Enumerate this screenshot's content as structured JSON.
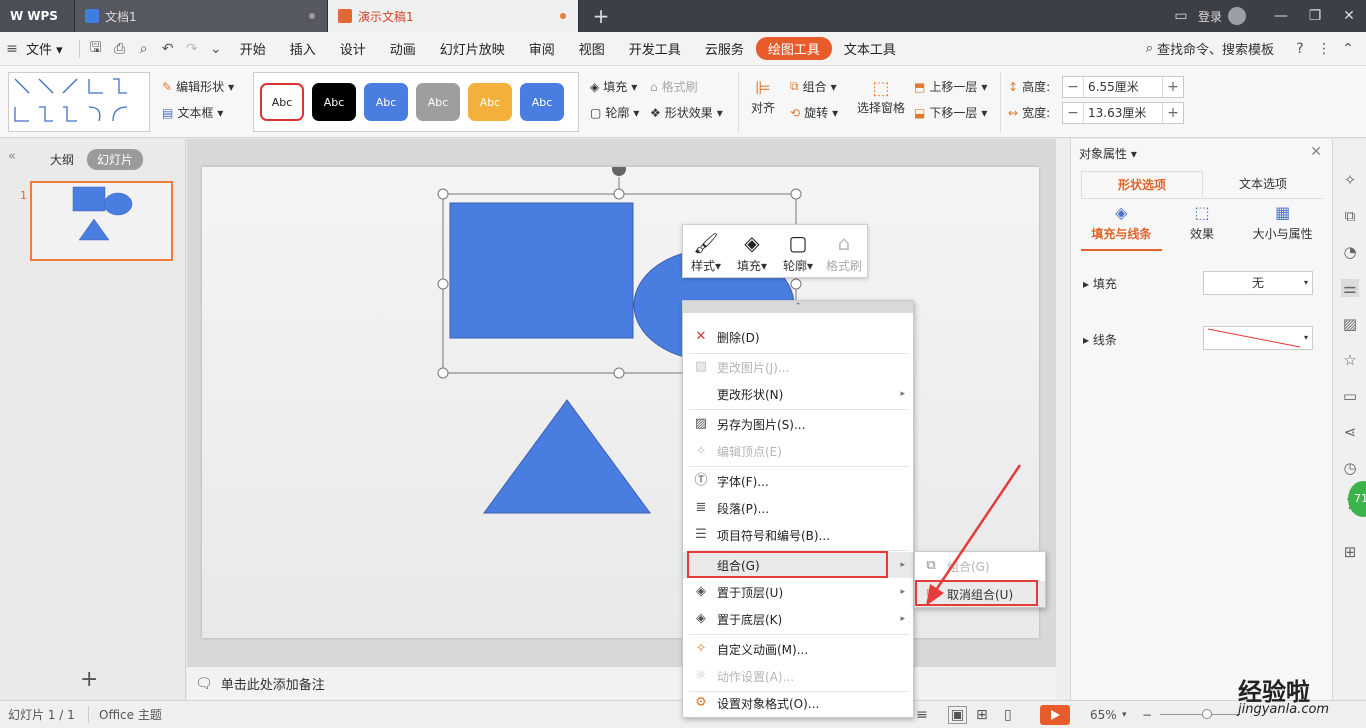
{
  "titlebar": {
    "wps_label": "WPS",
    "doc_tab": "文档1",
    "active_tab": "演示文稿1",
    "login": "登录"
  },
  "menubar": {
    "file": "文件",
    "items": [
      "开始",
      "插入",
      "设计",
      "动画",
      "幻灯片放映",
      "审阅",
      "视图",
      "开发工具",
      "云服务"
    ],
    "highlight": "绘图工具",
    "text_tools": "文本工具",
    "search": "查找命令、搜索模板"
  },
  "ribbon": {
    "edit_shape": "编辑形状",
    "text_box": "文本框",
    "style_samples": [
      "Abc",
      "Abc",
      "Abc",
      "Abc",
      "Abc",
      "Abc"
    ],
    "style_colors": [
      "#ffffff",
      "#000000",
      "#4a7de0",
      "#9e9e9e",
      "#f3b13b",
      "#4a7de0"
    ],
    "fill": "填充",
    "format_brush": "格式刷",
    "outline": "轮廓",
    "shape_effects": "形状效果",
    "align": "对齐",
    "group": "组合",
    "rotate": "旋转",
    "selection_pane": "选择窗格",
    "bring_forward": "上移一层",
    "send_backward": "下移一层",
    "height_label": "高度:",
    "height_value": "6.55厘米",
    "width_label": "宽度:",
    "width_value": "13.63厘米"
  },
  "leftpanel": {
    "outline": "大纲",
    "slides": "幻灯片",
    "slide_number": "1"
  },
  "notes": "单击此处添加备注",
  "floatbar": {
    "style": "样式",
    "fill": "填充",
    "outline": "轮廓",
    "format_brush": "格式刷"
  },
  "context_menu": {
    "delete": "删除(D)",
    "change_picture": "更改图片(J)...",
    "change_shape": "更改形状(N)",
    "save_as_picture": "另存为图片(S)...",
    "edit_points": "编辑顶点(E)",
    "font": "字体(F)...",
    "paragraph": "段落(P)...",
    "bullets": "项目符号和编号(B)...",
    "group": "组合(G)",
    "bring_to_front": "置于顶层(U)",
    "send_to_back": "置于底层(K)",
    "custom_animation": "自定义动画(M)...",
    "action_settings": "动作设置(A)...",
    "format_object": "设置对象格式(O)..."
  },
  "submenu": {
    "group": "组合(G)",
    "ungroup": "取消组合(U)"
  },
  "rightpanel": {
    "title": "对象属性",
    "tab_shape": "形状选项",
    "tab_text": "文本选项",
    "sub_fill_line": "填充与线条",
    "sub_effects": "效果",
    "sub_size": "大小与属性",
    "fill_label": "填充",
    "fill_value": "无",
    "line_label": "线条"
  },
  "statusbar": {
    "slide_info": "幻灯片 1 / 1",
    "theme": "Office 主题",
    "zoom": "65%"
  },
  "watermark": {
    "text": "经验啦",
    "url": "jingyanla.com"
  }
}
